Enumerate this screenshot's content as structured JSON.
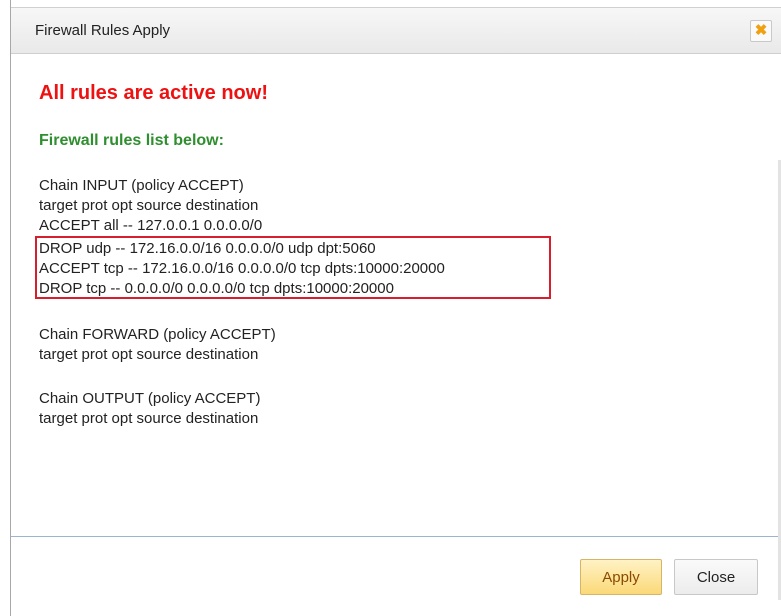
{
  "dialog": {
    "title": "Firewall Rules Apply",
    "close_symbol": "✖"
  },
  "message": {
    "headline": "All rules are active now!",
    "subheading": "Firewall rules list below:"
  },
  "rules": {
    "input_chain": "Chain INPUT (policy ACCEPT)",
    "input_header": "target prot opt source destination",
    "input_rule_1": "ACCEPT all -- 127.0.0.1 0.0.0.0/0",
    "input_rule_2": "DROP udp -- 172.16.0.0/16 0.0.0.0/0 udp dpt:5060",
    "input_rule_3": "ACCEPT tcp -- 172.16.0.0/16 0.0.0.0/0 tcp dpts:10000:20000",
    "input_rule_4": "DROP tcp -- 0.0.0.0/0 0.0.0.0/0 tcp dpts:10000:20000",
    "forward_chain": "Chain FORWARD (policy ACCEPT)",
    "forward_header": "target prot opt source destination",
    "output_chain": "Chain OUTPUT (policy ACCEPT)",
    "output_header": "target prot opt source destination"
  },
  "buttons": {
    "apply": "Apply",
    "close": "Close"
  },
  "colors": {
    "headline": "#ee1111",
    "subheading": "#2f8f2f",
    "highlight_box": "#d61e2d",
    "close_icon": "#f0a010"
  }
}
